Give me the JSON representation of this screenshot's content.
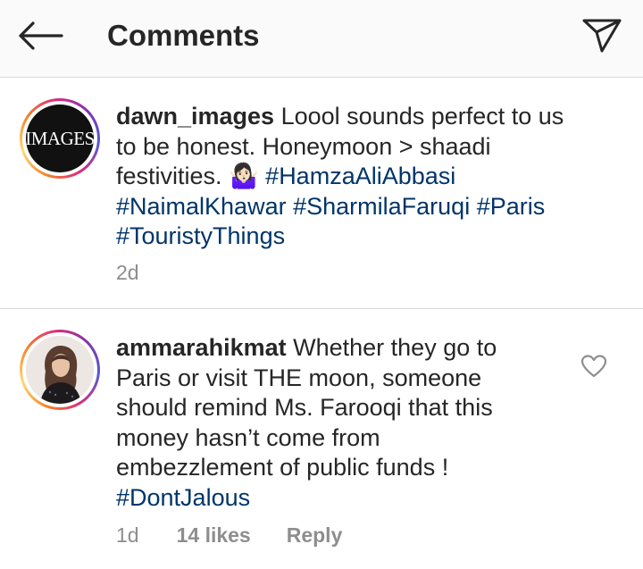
{
  "header": {
    "back_icon": "arrow-left-icon",
    "title": "Comments",
    "share_icon": "paper-plane-icon"
  },
  "comments": [
    {
      "avatar_logo": "IMAGES",
      "username": "dawn_images",
      "text": "Loool sounds perfect to us to be honest. Honeymoon > shaadi festivities. 🤷🏻‍♀️",
      "hashtags": [
        "#HamzaAliAbbasi",
        "#NaimalKhawar",
        "#SharmilaFaruqi",
        "#Paris",
        "#TouristyThings"
      ],
      "time": "2d"
    },
    {
      "username": "ammarahikmat",
      "text": "Whether they go to Paris or visit THE moon, someone should remind Ms. Farooqi that this money hasn’t come from embezzlement of public funds !",
      "hashtags": [
        "#DontJalous"
      ],
      "time": "1d",
      "likes": "14 likes",
      "reply_label": "Reply",
      "like_icon": "heart-outline-icon"
    }
  ],
  "colors": {
    "hashtag": "#003569",
    "meta": "#8e8e8e",
    "text": "#262626",
    "header_bg": "#fafafa"
  }
}
